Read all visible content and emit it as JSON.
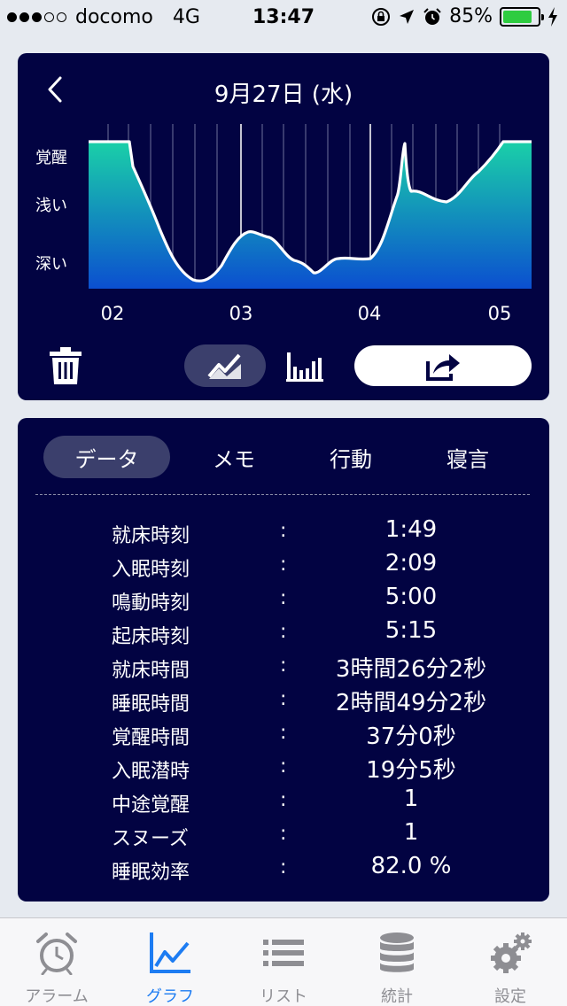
{
  "status": {
    "carrier": "docomo",
    "network": "4G",
    "time": "13:47",
    "battery": "85%",
    "battery_level": 0.85
  },
  "graph": {
    "date": "9月27日 (水)",
    "y_labels": [
      "覚醒",
      "浅い",
      "深い"
    ],
    "x_labels": [
      "02",
      "03",
      "04",
      "05"
    ],
    "gradient_top": "#1ad0a8",
    "gradient_bottom": "#0b4fd0"
  },
  "tabs": [
    {
      "label": "データ",
      "active": true
    },
    {
      "label": "メモ",
      "active": false
    },
    {
      "label": "行動",
      "active": false
    },
    {
      "label": "寝言",
      "active": false
    }
  ],
  "stats": [
    {
      "label": "就床時刻",
      "value": "1:49"
    },
    {
      "label": "入眠時刻",
      "value": "2:09"
    },
    {
      "label": "鳴動時刻",
      "value": "5:00"
    },
    {
      "label": "起床時刻",
      "value": "5:15"
    },
    {
      "label": "就床時間",
      "value": "3時間26分2秒"
    },
    {
      "label": "睡眠時間",
      "value": "2時間49分2秒"
    },
    {
      "label": "覚醒時間",
      "value": "37分0秒"
    },
    {
      "label": "入眠潜時",
      "value": "19分5秒"
    },
    {
      "label": "中途覚醒",
      "value": "1"
    },
    {
      "label": "スヌーズ",
      "value": "1"
    },
    {
      "label": "睡眠効率",
      "value": "82.0 %"
    }
  ],
  "colon": ":",
  "tabbar": [
    {
      "label": "アラーム",
      "icon": "alarm-clock-icon"
    },
    {
      "label": "グラフ",
      "icon": "line-graph-icon"
    },
    {
      "label": "リスト",
      "icon": "list-icon"
    },
    {
      "label": "統計",
      "icon": "database-icon"
    },
    {
      "label": "設定",
      "icon": "gears-icon"
    }
  ],
  "accent_color": "#1d7cf2",
  "panel_color": "#020342"
}
